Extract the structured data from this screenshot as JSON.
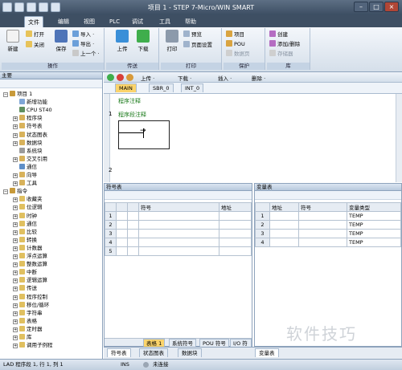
{
  "window": {
    "title": "项目 1 - STEP 7-Micro/WIN SMART"
  },
  "ribbon_tabs": [
    "文件",
    "编辑",
    "视图",
    "PLC",
    "调试",
    "工具",
    "帮助"
  ],
  "ribbon": {
    "groups": {
      "operation": "操作",
      "transfer": "传送",
      "print": "打印",
      "protect": "保护",
      "library": "库"
    },
    "new": "新建",
    "open": "打开",
    "close": "关闭",
    "save": "保存",
    "import": "导入 ·",
    "export": "导出 ·",
    "recent": "上一个 ·",
    "upload": "上传",
    "download": "下载",
    "print_btn": "打印",
    "preview": "预览",
    "page_setup": "页面设置",
    "project": "项目",
    "pou": "POU",
    "datapage": "数据页",
    "create": "创建",
    "add_remove": "添加/删除",
    "memory": "存储器"
  },
  "left_panel": {
    "title": "主要",
    "items": [
      {
        "label": "项目 1",
        "exp": "−",
        "color": "#c89a3a"
      },
      {
        "label": "新增功能",
        "exp": "",
        "color": "#7fa6d6"
      },
      {
        "label": "CPU ST40",
        "exp": "",
        "color": "#5f8f5f"
      },
      {
        "label": "程序块",
        "exp": "+",
        "color": "#d8b25b"
      },
      {
        "label": "符号表",
        "exp": "+",
        "color": "#d8b25b"
      },
      {
        "label": "状态图表",
        "exp": "+",
        "color": "#d8b25b"
      },
      {
        "label": "数据块",
        "exp": "+",
        "color": "#d8b25b"
      },
      {
        "label": "系统块",
        "exp": "",
        "color": "#9b9b9b"
      },
      {
        "label": "交叉引用",
        "exp": "+",
        "color": "#d8b25b"
      },
      {
        "label": "通信",
        "exp": "",
        "color": "#5f8fc8"
      },
      {
        "label": "向导",
        "exp": "+",
        "color": "#d8b25b"
      },
      {
        "label": "工具",
        "exp": "+",
        "color": "#d8b25b"
      },
      {
        "label": "指令",
        "exp": "−",
        "color": "#c89a3a"
      },
      {
        "label": "收藏夹",
        "exp": "+",
        "color": "#e0c060"
      },
      {
        "label": "位逻辑",
        "exp": "+",
        "color": "#e0c060"
      },
      {
        "label": "时钟",
        "exp": "+",
        "color": "#e0c060"
      },
      {
        "label": "通信",
        "exp": "+",
        "color": "#e0c060"
      },
      {
        "label": "比较",
        "exp": "+",
        "color": "#e0c060"
      },
      {
        "label": "转换",
        "exp": "+",
        "color": "#e0c060"
      },
      {
        "label": "计数器",
        "exp": "+",
        "color": "#e0c060"
      },
      {
        "label": "浮点运算",
        "exp": "+",
        "color": "#e0c060"
      },
      {
        "label": "整数运算",
        "exp": "+",
        "color": "#e0c060"
      },
      {
        "label": "中断",
        "exp": "+",
        "color": "#e0c060"
      },
      {
        "label": "逻辑运算",
        "exp": "+",
        "color": "#e0c060"
      },
      {
        "label": "传送",
        "exp": "+",
        "color": "#e0c060"
      },
      {
        "label": "程序控制",
        "exp": "+",
        "color": "#e0c060"
      },
      {
        "label": "移位/循环",
        "exp": "+",
        "color": "#e0c060"
      },
      {
        "label": "字符串",
        "exp": "+",
        "color": "#e0c060"
      },
      {
        "label": "表格",
        "exp": "+",
        "color": "#e0c060"
      },
      {
        "label": "定时器",
        "exp": "+",
        "color": "#e0c060"
      },
      {
        "label": "库",
        "exp": "+",
        "color": "#e0c060"
      },
      {
        "label": "调用子例程",
        "exp": "+",
        "color": "#e0c060"
      }
    ]
  },
  "editor": {
    "toolbar": {
      "upload": "上传 ·",
      "download": "下载 ·",
      "insert": "插入 ·",
      "delete": "删除 ·"
    },
    "tabs": [
      "MAIN",
      "SBR_0",
      "INT_0"
    ],
    "program_comment": "程序注释",
    "network_number": "1",
    "network_comment": "程序段注释",
    "network2_number": "2"
  },
  "symbol_table": {
    "title": "符号表",
    "headers": [
      "符号",
      "地址"
    ],
    "rows": [
      "1",
      "2",
      "3",
      "4",
      "5"
    ],
    "bottom_tabs": [
      "表格 1",
      "系统符号",
      "POU 符号",
      "I/O 符号"
    ]
  },
  "variable_table": {
    "title": "变量表",
    "headers": [
      "地址",
      "符号",
      "变量类型"
    ],
    "rows": [
      {
        "n": "1",
        "type": "TEMP"
      },
      {
        "n": "2",
        "type": "TEMP"
      },
      {
        "n": "3",
        "type": "TEMP"
      },
      {
        "n": "4",
        "type": "TEMP"
      }
    ]
  },
  "bottom_tabs": [
    "符号表",
    "状态图表",
    "数据块"
  ],
  "variable_tab": "变量表",
  "status": {
    "position": "LAD 程序段 1, 行 1, 列 1",
    "mode": "INS",
    "connection": "未连接"
  },
  "watermark": "软件技巧"
}
